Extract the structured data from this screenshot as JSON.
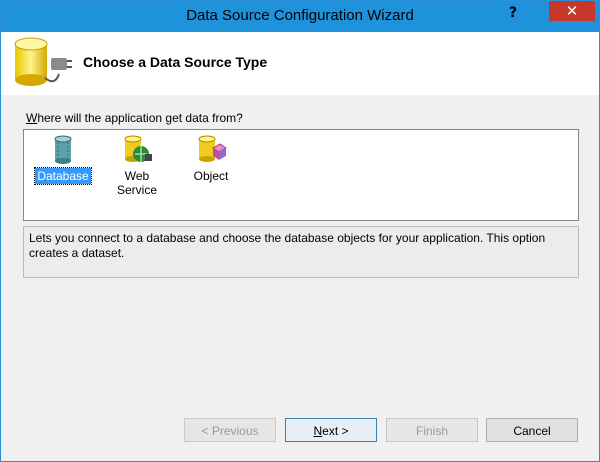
{
  "window": {
    "title": "Data Source Configuration Wizard",
    "help_label": "?",
    "close_label": "✕"
  },
  "header": {
    "heading": "Choose a Data Source Type",
    "icon": "database-plug-icon"
  },
  "prompt": {
    "mnemonic": "W",
    "rest": "here will the application get data from?"
  },
  "sources": [
    {
      "label": "Database",
      "icon": "database-icon",
      "selected": true
    },
    {
      "label": "Web Service",
      "icon": "web-service-icon",
      "selected": false
    },
    {
      "label": "Object",
      "icon": "object-icon",
      "selected": false
    }
  ],
  "description": "Lets you connect to a database and choose the database objects for your application. This option creates a dataset.",
  "buttons": {
    "previous": "< Previous",
    "next_mnemonic": "N",
    "next_rest": "ext >",
    "finish": "Finish",
    "cancel": "Cancel"
  },
  "colors": {
    "titlebar": "#1e93dc",
    "close": "#c7372b",
    "selection": "#3399ff"
  }
}
